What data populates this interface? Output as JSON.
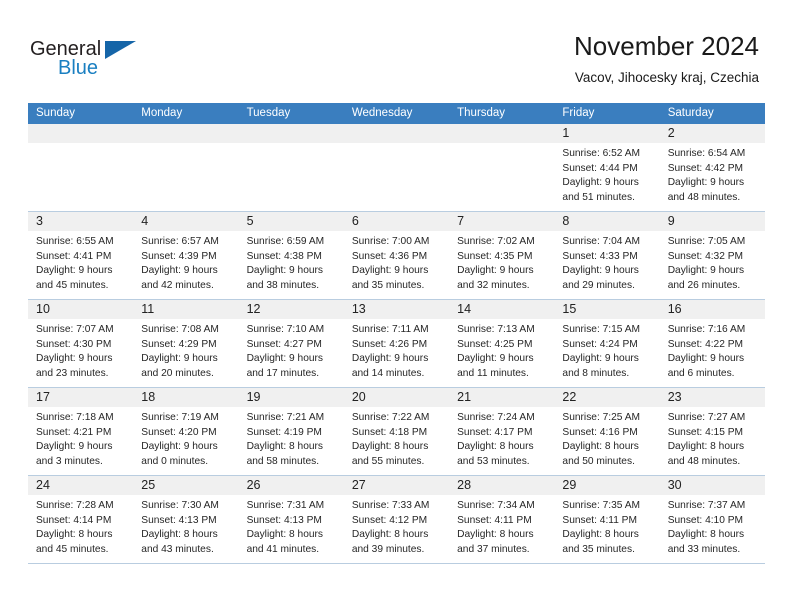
{
  "logo": {
    "word_top": "General",
    "word_bottom": "Blue",
    "triangle_icon": "blue-triangle-icon",
    "top_color": "#231f20",
    "bottom_color": "#1a7fc1",
    "triangle_color": "#1565a8"
  },
  "header": {
    "month_title": "November 2024",
    "location": "Vacov, Jihocesky kraj, Czechia"
  },
  "colors": {
    "header_bar": "#3a7ebf",
    "day_band": "#f0f0f0",
    "row_divider": "#b9cde0",
    "text": "#262626"
  },
  "calendar": {
    "weekday_headers": [
      "Sunday",
      "Monday",
      "Tuesday",
      "Wednesday",
      "Thursday",
      "Friday",
      "Saturday"
    ],
    "weeks": [
      [
        {
          "day": "",
          "lines": []
        },
        {
          "day": "",
          "lines": []
        },
        {
          "day": "",
          "lines": []
        },
        {
          "day": "",
          "lines": []
        },
        {
          "day": "",
          "lines": []
        },
        {
          "day": "1",
          "lines": [
            "Sunrise: 6:52 AM",
            "Sunset: 4:44 PM",
            "Daylight: 9 hours",
            "and 51 minutes."
          ]
        },
        {
          "day": "2",
          "lines": [
            "Sunrise: 6:54 AM",
            "Sunset: 4:42 PM",
            "Daylight: 9 hours",
            "and 48 minutes."
          ]
        }
      ],
      [
        {
          "day": "3",
          "lines": [
            "Sunrise: 6:55 AM",
            "Sunset: 4:41 PM",
            "Daylight: 9 hours",
            "and 45 minutes."
          ]
        },
        {
          "day": "4",
          "lines": [
            "Sunrise: 6:57 AM",
            "Sunset: 4:39 PM",
            "Daylight: 9 hours",
            "and 42 minutes."
          ]
        },
        {
          "day": "5",
          "lines": [
            "Sunrise: 6:59 AM",
            "Sunset: 4:38 PM",
            "Daylight: 9 hours",
            "and 38 minutes."
          ]
        },
        {
          "day": "6",
          "lines": [
            "Sunrise: 7:00 AM",
            "Sunset: 4:36 PM",
            "Daylight: 9 hours",
            "and 35 minutes."
          ]
        },
        {
          "day": "7",
          "lines": [
            "Sunrise: 7:02 AM",
            "Sunset: 4:35 PM",
            "Daylight: 9 hours",
            "and 32 minutes."
          ]
        },
        {
          "day": "8",
          "lines": [
            "Sunrise: 7:04 AM",
            "Sunset: 4:33 PM",
            "Daylight: 9 hours",
            "and 29 minutes."
          ]
        },
        {
          "day": "9",
          "lines": [
            "Sunrise: 7:05 AM",
            "Sunset: 4:32 PM",
            "Daylight: 9 hours",
            "and 26 minutes."
          ]
        }
      ],
      [
        {
          "day": "10",
          "lines": [
            "Sunrise: 7:07 AM",
            "Sunset: 4:30 PM",
            "Daylight: 9 hours",
            "and 23 minutes."
          ]
        },
        {
          "day": "11",
          "lines": [
            "Sunrise: 7:08 AM",
            "Sunset: 4:29 PM",
            "Daylight: 9 hours",
            "and 20 minutes."
          ]
        },
        {
          "day": "12",
          "lines": [
            "Sunrise: 7:10 AM",
            "Sunset: 4:27 PM",
            "Daylight: 9 hours",
            "and 17 minutes."
          ]
        },
        {
          "day": "13",
          "lines": [
            "Sunrise: 7:11 AM",
            "Sunset: 4:26 PM",
            "Daylight: 9 hours",
            "and 14 minutes."
          ]
        },
        {
          "day": "14",
          "lines": [
            "Sunrise: 7:13 AM",
            "Sunset: 4:25 PM",
            "Daylight: 9 hours",
            "and 11 minutes."
          ]
        },
        {
          "day": "15",
          "lines": [
            "Sunrise: 7:15 AM",
            "Sunset: 4:24 PM",
            "Daylight: 9 hours",
            "and 8 minutes."
          ]
        },
        {
          "day": "16",
          "lines": [
            "Sunrise: 7:16 AM",
            "Sunset: 4:22 PM",
            "Daylight: 9 hours",
            "and 6 minutes."
          ]
        }
      ],
      [
        {
          "day": "17",
          "lines": [
            "Sunrise: 7:18 AM",
            "Sunset: 4:21 PM",
            "Daylight: 9 hours",
            "and 3 minutes."
          ]
        },
        {
          "day": "18",
          "lines": [
            "Sunrise: 7:19 AM",
            "Sunset: 4:20 PM",
            "Daylight: 9 hours",
            "and 0 minutes."
          ]
        },
        {
          "day": "19",
          "lines": [
            "Sunrise: 7:21 AM",
            "Sunset: 4:19 PM",
            "Daylight: 8 hours",
            "and 58 minutes."
          ]
        },
        {
          "day": "20",
          "lines": [
            "Sunrise: 7:22 AM",
            "Sunset: 4:18 PM",
            "Daylight: 8 hours",
            "and 55 minutes."
          ]
        },
        {
          "day": "21",
          "lines": [
            "Sunrise: 7:24 AM",
            "Sunset: 4:17 PM",
            "Daylight: 8 hours",
            "and 53 minutes."
          ]
        },
        {
          "day": "22",
          "lines": [
            "Sunrise: 7:25 AM",
            "Sunset: 4:16 PM",
            "Daylight: 8 hours",
            "and 50 minutes."
          ]
        },
        {
          "day": "23",
          "lines": [
            "Sunrise: 7:27 AM",
            "Sunset: 4:15 PM",
            "Daylight: 8 hours",
            "and 48 minutes."
          ]
        }
      ],
      [
        {
          "day": "24",
          "lines": [
            "Sunrise: 7:28 AM",
            "Sunset: 4:14 PM",
            "Daylight: 8 hours",
            "and 45 minutes."
          ]
        },
        {
          "day": "25",
          "lines": [
            "Sunrise: 7:30 AM",
            "Sunset: 4:13 PM",
            "Daylight: 8 hours",
            "and 43 minutes."
          ]
        },
        {
          "day": "26",
          "lines": [
            "Sunrise: 7:31 AM",
            "Sunset: 4:13 PM",
            "Daylight: 8 hours",
            "and 41 minutes."
          ]
        },
        {
          "day": "27",
          "lines": [
            "Sunrise: 7:33 AM",
            "Sunset: 4:12 PM",
            "Daylight: 8 hours",
            "and 39 minutes."
          ]
        },
        {
          "day": "28",
          "lines": [
            "Sunrise: 7:34 AM",
            "Sunset: 4:11 PM",
            "Daylight: 8 hours",
            "and 37 minutes."
          ]
        },
        {
          "day": "29",
          "lines": [
            "Sunrise: 7:35 AM",
            "Sunset: 4:11 PM",
            "Daylight: 8 hours",
            "and 35 minutes."
          ]
        },
        {
          "day": "30",
          "lines": [
            "Sunrise: 7:37 AM",
            "Sunset: 4:10 PM",
            "Daylight: 8 hours",
            "and 33 minutes."
          ]
        }
      ]
    ]
  }
}
